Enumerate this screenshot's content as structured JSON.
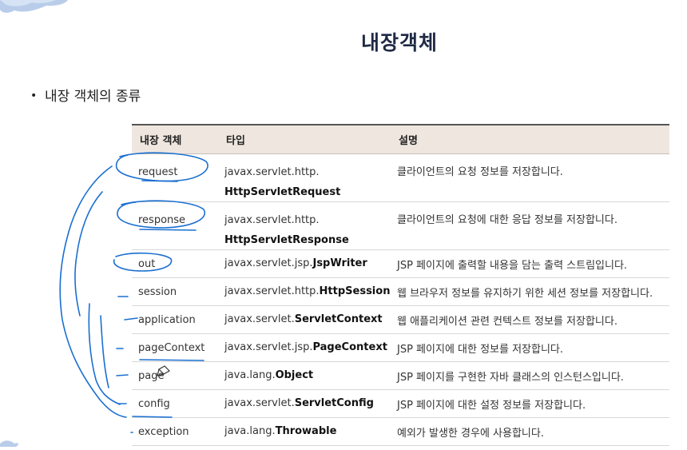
{
  "title": "내장객체",
  "bullet": "내장 객체의 종류",
  "table": {
    "headers": [
      "내장 객체",
      "타입",
      "설명"
    ],
    "rows": [
      {
        "name": "request",
        "type_prefix": "javax.servlet.http.",
        "type_class": "HttpServletRequest",
        "desc": "클라이언트의 요청 정보를 저장합니다."
      },
      {
        "name": "response",
        "type_prefix": "javax.servlet.http.",
        "type_class": "HttpServletResponse",
        "desc": "클라이언트의 요청에 대한 응답 정보를 저장합니다."
      },
      {
        "name": "out",
        "type_prefix": "javax.servlet.jsp.",
        "type_class": "JspWriter",
        "desc": "JSP 페이지에 출력할 내용을 담는 출력 스트림입니다."
      },
      {
        "name": "session",
        "type_prefix": "javax.servlet.http.",
        "type_class": "HttpSession",
        "desc": "웹 브라우저 정보를 유지하기 위한 세션 정보를 저장합니다."
      },
      {
        "name": "application",
        "type_prefix": "javax.servlet.",
        "type_class": "ServletContext",
        "desc": "웹 애플리케이션 관련 컨텍스트 정보를 저장합니다."
      },
      {
        "name": "pageContext",
        "type_prefix": "javax.servlet.jsp.",
        "type_class": "PageContext",
        "desc": "JSP 페이지에 대한 정보를 저장합니다."
      },
      {
        "name": "page",
        "type_prefix": "java.lang.",
        "type_class": "Object",
        "desc": "JSP 페이지를 구현한  자바 클래스의 인스턴스입니다."
      },
      {
        "name": "config",
        "type_prefix": "javax.servlet.",
        "type_class": "ServletConfig",
        "desc": "JSP 페이지에 대한 설정 정보를 저장합니다."
      },
      {
        "name": "exception",
        "type_prefix": "java.lang.",
        "type_class": "Throwable",
        "desc": "예외가 발생한 경우에 사용합니다."
      }
    ]
  },
  "colors": {
    "title": "#1f2a44",
    "header_bg": "#efe7df",
    "annotation": "#1a6fd1"
  }
}
